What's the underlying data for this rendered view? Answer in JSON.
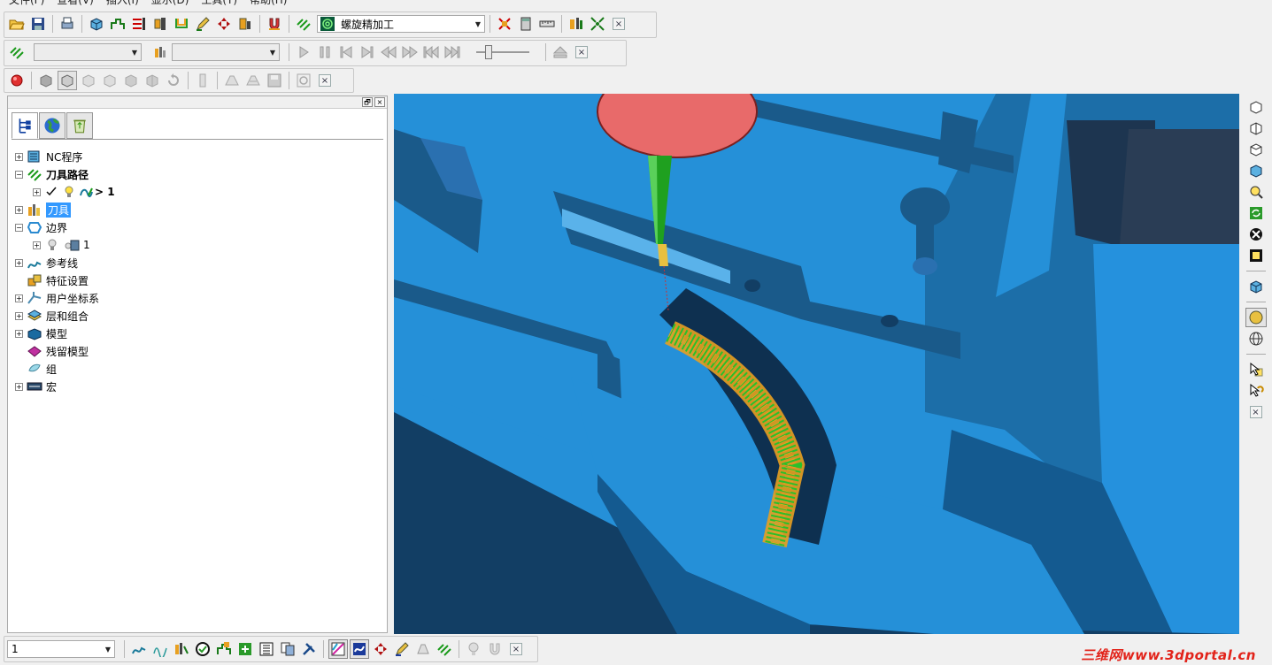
{
  "menu": [
    "文件(F)",
    "查看(V)",
    "插入(I)",
    "显示(D)",
    "工具(T)",
    "帮助(H)"
  ],
  "toolbar1": {
    "strategy_combo": "螺旋精加工",
    "close": "×"
  },
  "toolbar2": {
    "combo_a": "",
    "combo_b": "",
    "slider_level": 0.2,
    "close": "×"
  },
  "toolbar3": {
    "close": "×"
  },
  "panel": {
    "head_buttons": [
      "🗗",
      "×"
    ],
    "tree": [
      {
        "label": "NC程序",
        "expand": "+",
        "bold": false,
        "selected": false,
        "icon": "nc-program-icon"
      },
      {
        "label": "刀具路径",
        "expand": "−",
        "bold": true,
        "selected": false,
        "icon": "toolpath-icon"
      },
      {
        "label": "> 1",
        "expand": "+",
        "bold": true,
        "selected": false,
        "icon": "toolpath-item-icon",
        "child": true
      },
      {
        "label": "刀具",
        "expand": "+",
        "bold": false,
        "selected": true,
        "icon": "tool-icon"
      },
      {
        "label": "边界",
        "expand": "−",
        "bold": false,
        "selected": false,
        "icon": "boundary-icon"
      },
      {
        "label": "1",
        "expand": "+",
        "bold": false,
        "selected": false,
        "icon": "boundary-item-icon",
        "child": true
      },
      {
        "label": "参考线",
        "expand": "+",
        "bold": false,
        "selected": false,
        "icon": "pattern-icon"
      },
      {
        "label": "特征设置",
        "expand": "",
        "bold": false,
        "selected": false,
        "icon": "feature-set-icon"
      },
      {
        "label": "用户坐标系",
        "expand": "+",
        "bold": false,
        "selected": false,
        "icon": "workplane-icon"
      },
      {
        "label": "层和组合",
        "expand": "+",
        "bold": false,
        "selected": false,
        "icon": "layers-icon"
      },
      {
        "label": "模型",
        "expand": "+",
        "bold": false,
        "selected": false,
        "icon": "model-icon"
      },
      {
        "label": "残留模型",
        "expand": "",
        "bold": false,
        "selected": false,
        "icon": "stock-model-icon"
      },
      {
        "label": "组",
        "expand": "",
        "bold": false,
        "selected": false,
        "icon": "group-icon"
      },
      {
        "label": "宏",
        "expand": "+",
        "bold": false,
        "selected": false,
        "icon": "macro-icon"
      }
    ]
  },
  "bottombar": {
    "combo_value": "1",
    "close": "×"
  },
  "right_toolbar": {
    "close": "×"
  },
  "watermark": "三维网www.3dportal.cn",
  "colors": {
    "viewport_bg": "#2590d8",
    "model_dark": "#1a5a8a",
    "tool_holder": "#e86a6a",
    "tool_shank": "#1fa01f",
    "toolpath": "#e8a020"
  }
}
